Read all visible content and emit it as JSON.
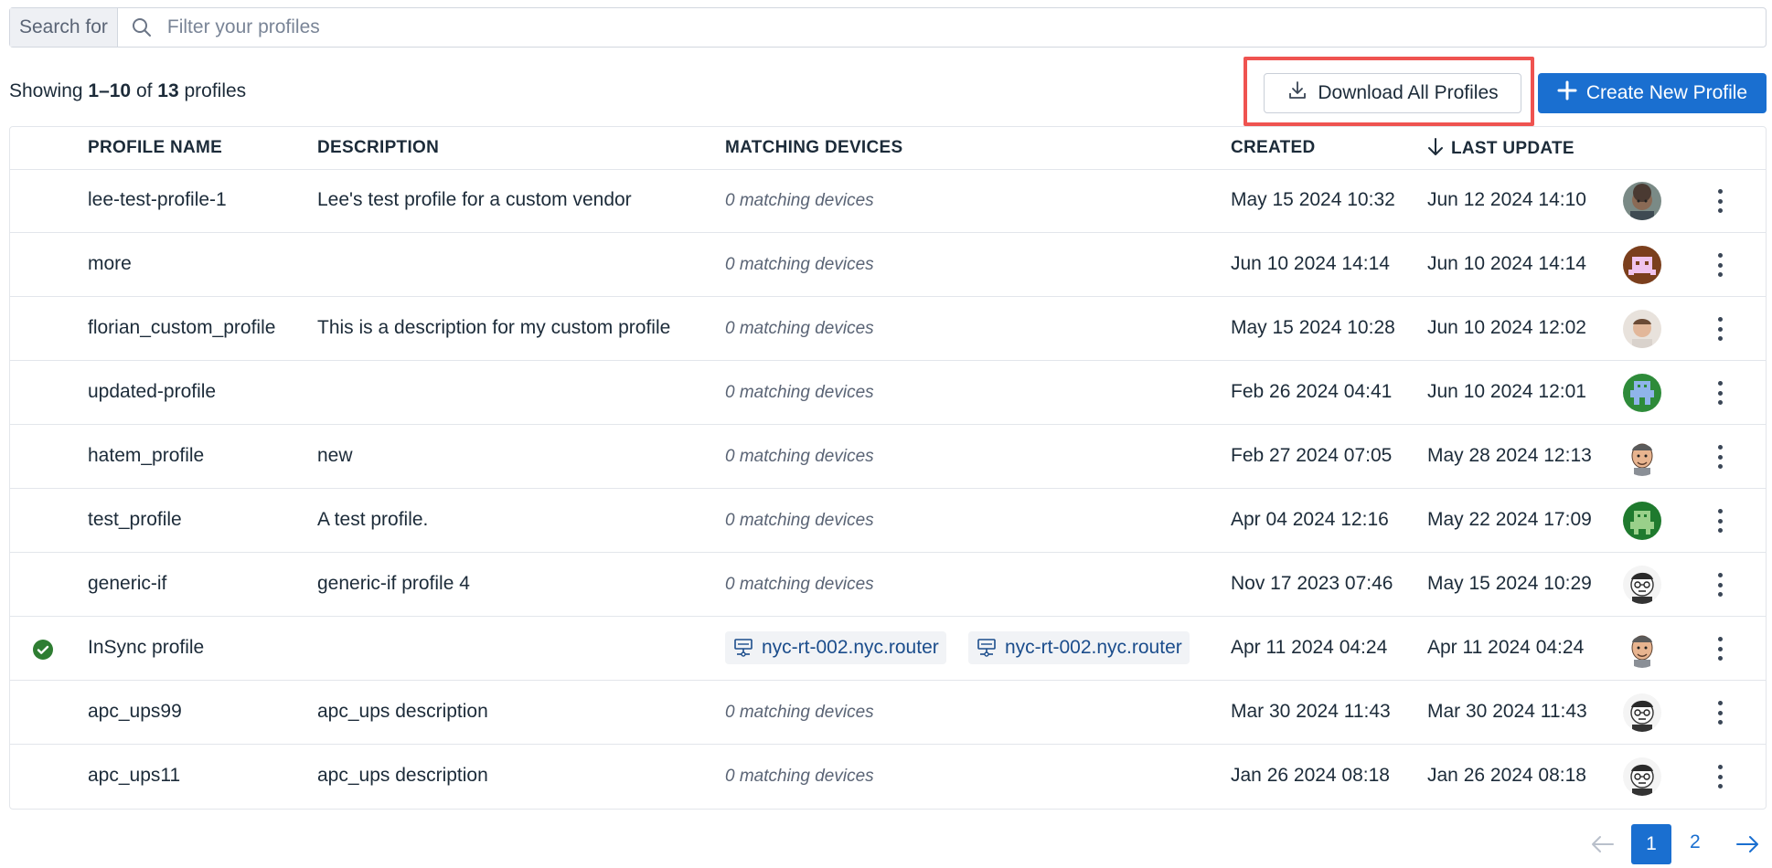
{
  "search": {
    "label": "Search for",
    "placeholder": "Filter your profiles"
  },
  "summary": {
    "prefix": "Showing ",
    "range": "1–10",
    "middle": " of ",
    "total": "13",
    "suffix": " profiles"
  },
  "toolbar": {
    "download_label": "Download All Profiles",
    "create_label": "Create New Profile"
  },
  "columns": {
    "name": "PROFILE NAME",
    "description": "DESCRIPTION",
    "matching": "MATCHING DEVICES",
    "created": "CREATED",
    "last_update": "LAST UPDATE"
  },
  "rows": [
    {
      "name": "lee-test-profile-1",
      "description": "Lee's test profile for a custom vendor",
      "matching": "0 matching devices",
      "created": "May 15 2024 10:32",
      "updated": "Jun 12 2024 14:10",
      "avatar": "photo-curly"
    },
    {
      "name": "more",
      "description": "",
      "matching": "0 matching devices",
      "created": "Jun 10 2024 14:14",
      "updated": "Jun 10 2024 14:14",
      "avatar": "pixel-brown"
    },
    {
      "name": "florian_custom_profile",
      "description": "This is a description for my custom profile",
      "matching": "0 matching devices",
      "created": "May 15 2024 10:28",
      "updated": "Jun 10 2024 12:02",
      "avatar": "photo-light"
    },
    {
      "name": "updated-profile",
      "description": "",
      "matching": "0 matching devices",
      "created": "Feb 26 2024 04:41",
      "updated": "Jun 10 2024 12:01",
      "avatar": "pixel-green"
    },
    {
      "name": "hatem_profile",
      "description": "new",
      "matching": "0 matching devices",
      "created": "Feb 27 2024 07:05",
      "updated": "May 28 2024 12:13",
      "avatar": "cartoon"
    },
    {
      "name": "test_profile",
      "description": "A test profile.",
      "matching": "0 matching devices",
      "created": "Apr 04 2024 12:16",
      "updated": "May 22 2024 17:09",
      "avatar": "pixel-green-2"
    },
    {
      "name": "generic-if",
      "description": "generic-if profile 4",
      "matching": "0 matching devices",
      "created": "Nov 17 2023 07:46",
      "updated": "May 15 2024 10:29",
      "avatar": "sketch"
    },
    {
      "name": "InSync profile",
      "description": "",
      "matching": "",
      "devices": [
        "nyc-rt-002.nyc.router",
        "nyc-rt-002.nyc.router"
      ],
      "created": "Apr 11 2024 04:24",
      "updated": "Apr 11 2024 04:24",
      "avatar": "cartoon",
      "synced": true
    },
    {
      "name": "apc_ups99",
      "description": "apc_ups description",
      "matching": "0 matching devices",
      "created": "Mar 30 2024 11:43",
      "updated": "Mar 30 2024 11:43",
      "avatar": "sketch"
    },
    {
      "name": "apc_ups11",
      "description": "apc_ups description",
      "matching": "0 matching devices",
      "created": "Jan 26 2024 08:18",
      "updated": "Jan 26 2024 08:18",
      "avatar": "sketch"
    }
  ],
  "pagination": {
    "current": "1",
    "next_page": "2"
  },
  "colors": {
    "primary": "#1a6fd0",
    "highlight": "#ef5350",
    "success": "#2e7d32"
  },
  "icons": {
    "search": "search-icon",
    "download": "download-icon",
    "plus": "plus-icon",
    "sort": "arrow-down-icon",
    "kebab": "kebab-menu-icon",
    "check": "check-circle-icon",
    "device": "router-icon",
    "prev": "arrow-left-icon",
    "next": "arrow-right-icon"
  }
}
